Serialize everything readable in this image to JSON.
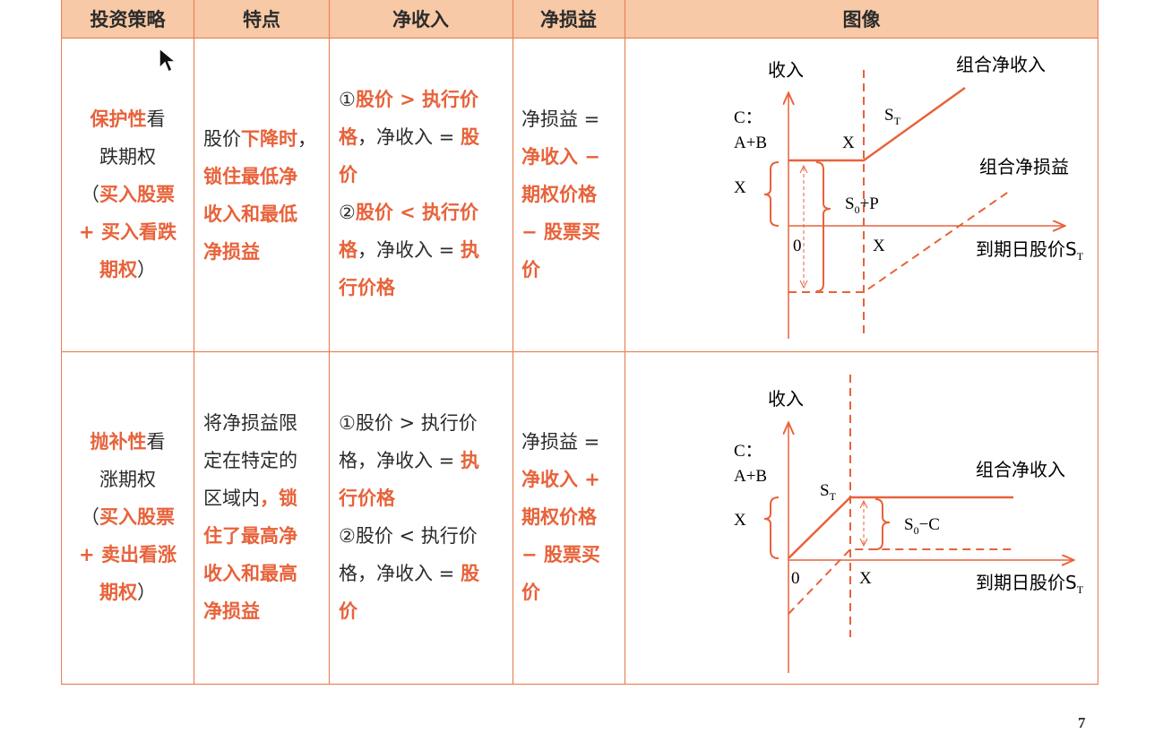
{
  "header": {
    "col1": "投资策略",
    "col2": "特点",
    "col3": "净收入",
    "col4": "净损益",
    "col5": "图像"
  },
  "row1": {
    "strategy": {
      "a": "保护性",
      "b": "看",
      "c": "跌期权",
      "d": "（",
      "e": "买入股票",
      "f": "+ 买入看跌",
      "g": "期权",
      "h": "）"
    },
    "feature": {
      "a": "股价",
      "b": "下降时",
      "c": "，",
      "d": "锁住最低净",
      "e": "收入和最低",
      "f": "净损益"
    },
    "income": {
      "a": "①",
      "b": "股价 > 执行价",
      "c": "格",
      "d": "，净收入 = ",
      "e": "股",
      "f": "价",
      "g": "②",
      "h": "股价 < 执行价",
      "i": "格",
      "j": "，净收入 = ",
      "k": "执",
      "l": "行价格"
    },
    "pnl": {
      "a": "净损益 =",
      "b": "净收入 −",
      "c": "期权价格",
      "d": "− 股票买",
      "e": "价"
    },
    "figure": {
      "y_axis": "收入",
      "x_axis": "到期日股价S",
      "x_axis_sub": "T",
      "c_label": "C：",
      "ab_label": "A+B",
      "x_left": "X",
      "x_top": "X",
      "x_bottom": "X",
      "zero": "0",
      "st": "S",
      "st_sub": "T",
      "s0p": "S",
      "s0p_sub": "0",
      "s0p_tail": "+P",
      "combo_income": "组合净收入",
      "combo_pnl": "组合净损益"
    }
  },
  "row2": {
    "strategy": {
      "a": "抛补性",
      "b": "看",
      "c": "涨期权",
      "d": "（",
      "e": "买入股票",
      "f": "+ 卖出看涨",
      "g": "期权",
      "h": "）"
    },
    "feature": {
      "a": "将净损益限",
      "b": "定在特定的",
      "c": "区域内",
      "d": "，锁",
      "e": "住了最高净",
      "f": "收入和最高",
      "g": "净损益"
    },
    "income": {
      "a": "①股价 > 执行价",
      "b": "格，净收入 = ",
      "c": "执",
      "d": "行价格",
      "e": "②股价 < 执行价",
      "f": "格，净收入 = ",
      "g": "股",
      "h": "价"
    },
    "pnl": {
      "a": "净损益 =",
      "b": "净收入 +",
      "c": "期权价格",
      "d": "− 股票买",
      "e": "价"
    },
    "figure": {
      "y_axis": "收入",
      "x_axis": "到期日股价S",
      "x_axis_sub": "T",
      "c_label": "C：",
      "ab_label": "A+B",
      "x_left": "X",
      "x_bottom": "X",
      "zero": "0",
      "st": "S",
      "st_sub": "T",
      "s0c": "S",
      "s0c_sub": "0",
      "s0c_tail": "−C",
      "combo_income": "组合净收入"
    }
  },
  "page_number": "7",
  "colors": {
    "accent": "#e8623a",
    "header_bg": "#f8c9a6",
    "border": "#e8845a"
  }
}
